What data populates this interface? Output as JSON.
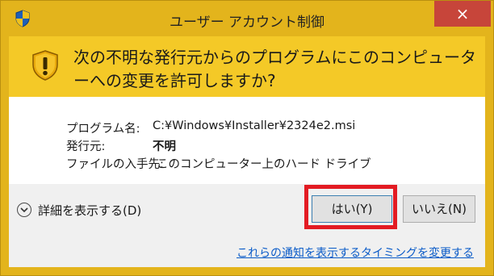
{
  "window": {
    "title": "ユーザー アカウント制御",
    "close_glyph": "×"
  },
  "header": {
    "question": "次の不明な発行元からのプログラムにこのコンピューターへの変更を許可しますか?"
  },
  "details_list": {
    "program_label": "プログラム名:",
    "program_value": "C:¥Windows¥Installer¥2324e2.msi",
    "publisher_label": "発行元:",
    "publisher_value": "不明",
    "origin_label": "ファイルの入手先:",
    "origin_value": "このコンピューター上のハード ドライブ"
  },
  "footer": {
    "show_details": "詳細を表示する(D)",
    "yes_label": "はい(Y)",
    "no_label": "いいえ(N)",
    "notify_link": "これらの通知を表示するタイミングを変更する"
  },
  "icons": {
    "title_icon": "shield-icon",
    "header_icon": "warning-shield-icon",
    "details_icon": "chevron-down-icon"
  },
  "colors": {
    "header_bg": "#f4c927",
    "border_bg": "#e3b41c",
    "close_bg": "#c7453a",
    "highlight": "#e31b23",
    "link": "#0a5bc8"
  }
}
